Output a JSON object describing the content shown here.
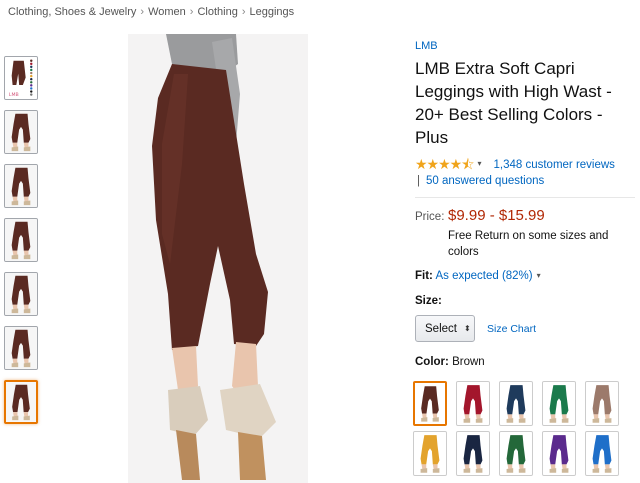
{
  "breadcrumb": [
    "Clothing, Shoes & Jewelry",
    "Women",
    "Clothing",
    "Leggings"
  ],
  "breadcrumb_separator": "›",
  "product": {
    "brand": "LMB",
    "title": "LMB Extra Soft Capri Leggings with High Wast - 20+ Best Selling Colors - Plus",
    "rating_stars": "★★★★⯪",
    "rating_value": 4.5,
    "reviews_text": "1,348 customer reviews",
    "qa_separator": "|",
    "answered_text": "50 answered questions",
    "price_label": "Price:",
    "price": "$9.99 - $15.99",
    "return_text": "Free Return on some sizes and colors",
    "fit_label": "Fit:",
    "fit_value": "As expected (82%)",
    "size_label": "Size:",
    "size_select_value": "Select",
    "size_chart_label": "Size Chart",
    "color_label": "Color:",
    "color_value": "Brown"
  },
  "icons": {
    "dropdown_caret": "▾",
    "select_arrows": "⬍"
  },
  "colors": {
    "link": "#0066c0",
    "price": "#b12704",
    "star": "#f0a41b",
    "selected_border": "#e77600",
    "legging_main": "#5a2a22"
  },
  "thumbnails": [
    {
      "name": "color-chart"
    },
    {
      "name": "brown-side"
    },
    {
      "name": "brown-side-2"
    },
    {
      "name": "brown-back"
    },
    {
      "name": "brown-front"
    },
    {
      "name": "brown-pose"
    },
    {
      "name": "brown-side-selected",
      "selected": true
    }
  ],
  "swatches": [
    {
      "color": "#5a2a22",
      "selected": true
    },
    {
      "color": "#a3162c"
    },
    {
      "color": "#1f3b5c"
    },
    {
      "color": "#1b7a4c"
    },
    {
      "color": "#9c7a6b"
    },
    {
      "color": "#e3a32d"
    },
    {
      "color": "#1a2642"
    },
    {
      "color": "#24683a"
    },
    {
      "color": "#5b2b8d"
    },
    {
      "color": "#1f6fc9"
    }
  ]
}
